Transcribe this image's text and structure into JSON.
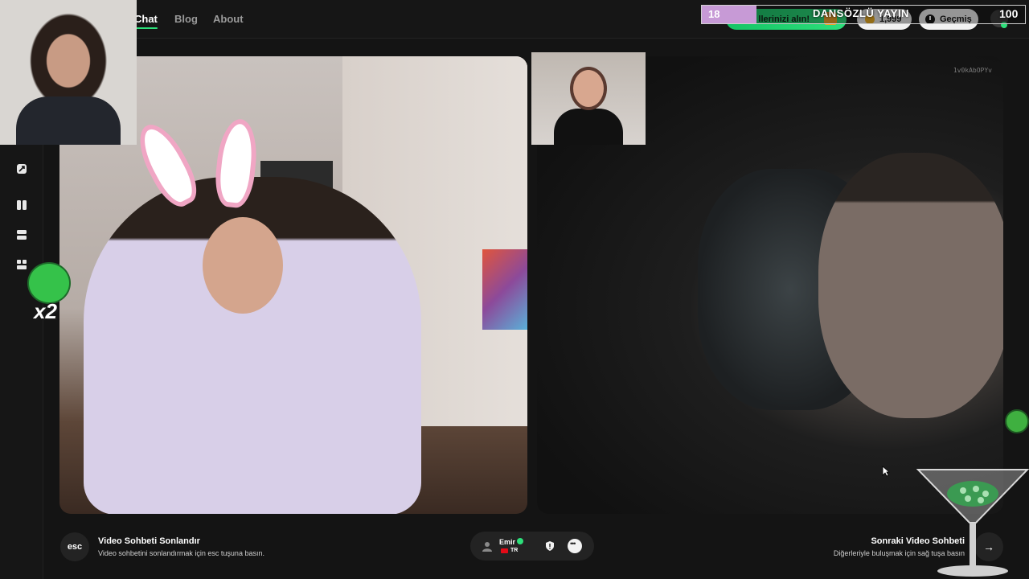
{
  "nav": {
    "links": [
      {
        "label": "Chat",
        "active": true
      },
      {
        "label": "Blog",
        "active": false
      },
      {
        "label": "About",
        "active": false
      }
    ]
  },
  "header": {
    "promo_label": "llerinizi alın!",
    "coins": "1,999",
    "history_label": "Geçmiş"
  },
  "stream_overlay": {
    "progress_value": "18",
    "title": "DANSÖZLÜ YAYIN",
    "goal": "100"
  },
  "video": {
    "peer_id": "1v0kAbOPYv"
  },
  "bottom": {
    "esc_label": "esc",
    "end_title": "Video Sohbeti Sonlandır",
    "end_sub": "Video sohbetini sonlandırmak için esc tuşuna basın.",
    "peer_name": "Emir",
    "peer_country": "TR",
    "next_title": "Sonraki Video Sohbeti",
    "next_sub": "Diğerleriyle buluşmak için sağ tuşa basın",
    "next_arrow": "→"
  },
  "sticker": {
    "multiplier": "x2"
  },
  "colors": {
    "accent": "#2de07b",
    "background": "#141414",
    "overlay_fill": "#c79ad6"
  },
  "icons": [
    "shuffle-icon",
    "layout-columns-icon",
    "layout-rows-icon",
    "layout-grid-icon",
    "clock-icon",
    "user-icon",
    "shield-icon",
    "chat-bubble-icon",
    "arrow-right-icon"
  ]
}
